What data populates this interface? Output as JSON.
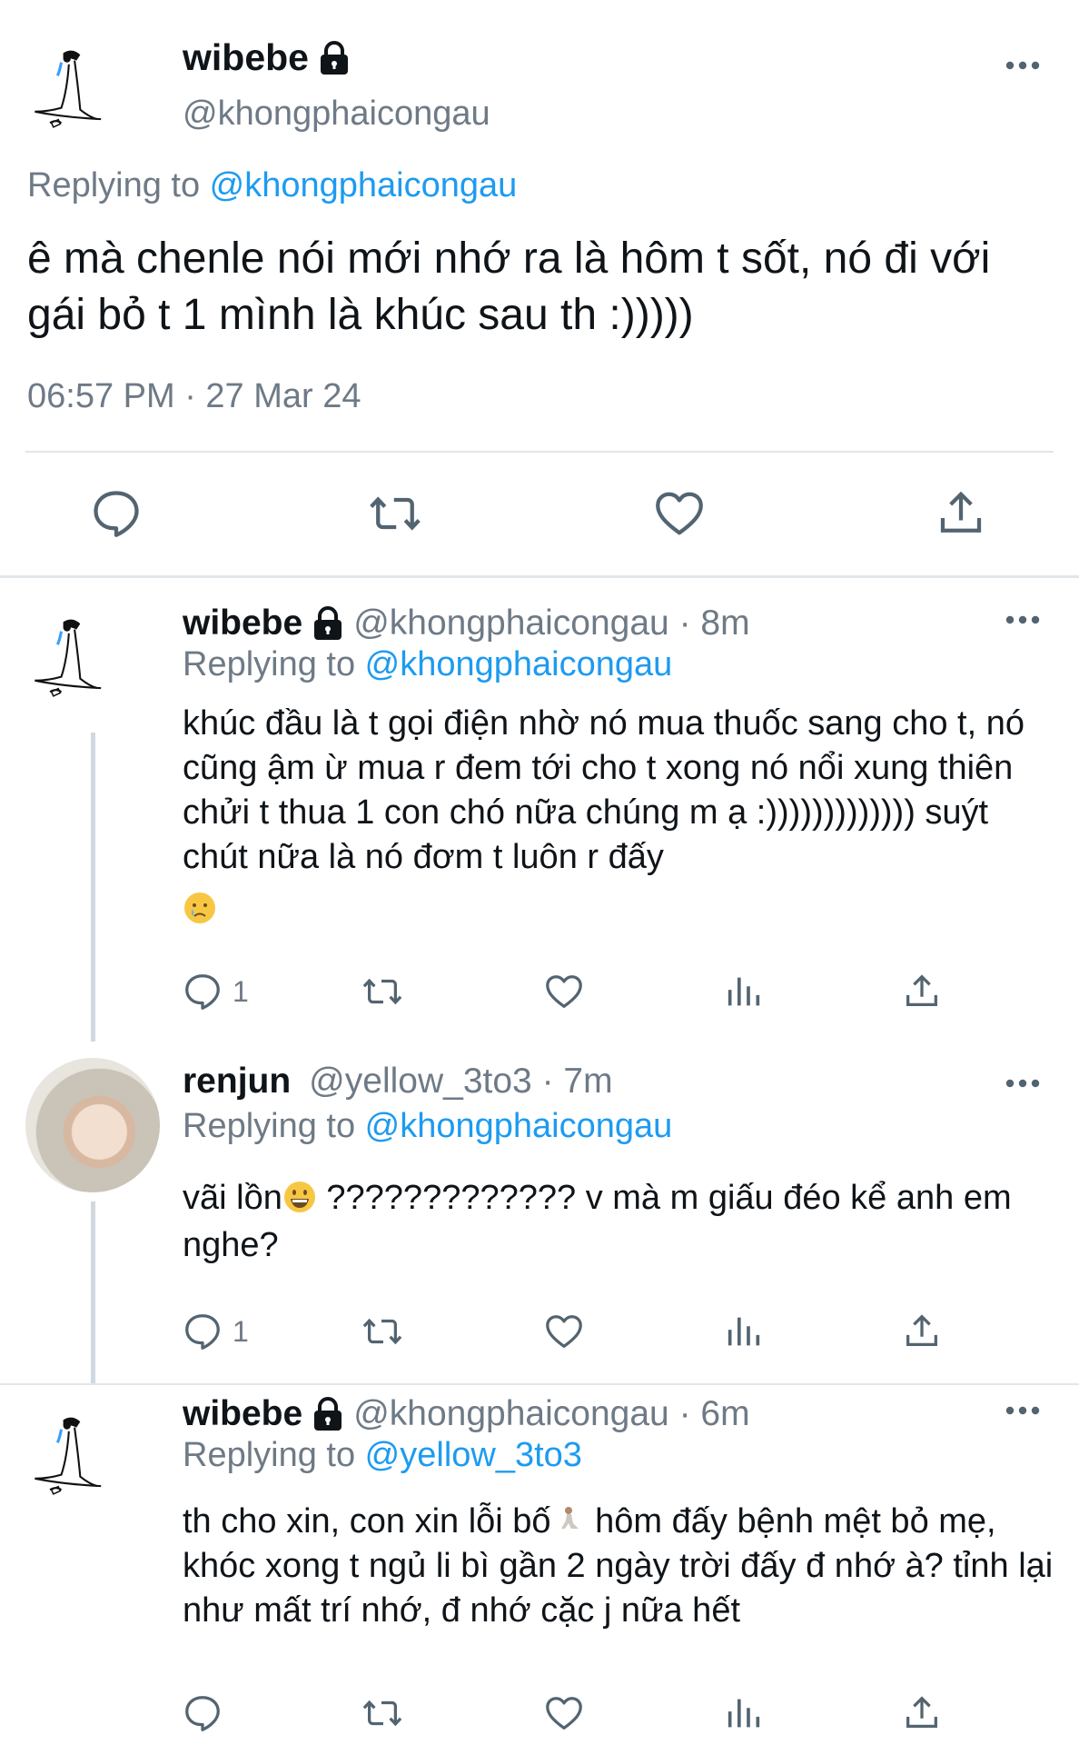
{
  "main": {
    "name": "wibebe",
    "handle": "@khongphaicongau",
    "replying_prefix": "Replying to ",
    "replying_to": "@khongphaicongau",
    "text": "ê mà chenle nói mới nhớ ra là hôm t sốt, nó đi với gái bỏ t 1 mình là khúc sau th :)))))",
    "timestamp": "06:57 PM · 27 Mar 24"
  },
  "replies": [
    {
      "name": "wibebe",
      "meta": "@khongphaicongau · 8m",
      "replying_prefix": "Replying to ",
      "replying_to": "@khongphaicongau",
      "text": "khúc đầu là t gọi điện nhờ nó mua thuốc sang cho t, nó cũng ậm ừ mua r đem tới cho t xong nó nổi xung thiên chửi t thua 1 con chó nữa chúng m ạ :))))))))))))) suýt chút nữa là nó đơm t luôn r đấy",
      "emoji": "crying-face",
      "reply_count": "1"
    },
    {
      "name": "renjun",
      "meta": "@yellow_3to3 · 7m",
      "replying_prefix": "Replying to ",
      "replying_to": "@khongphaicongau",
      "text_before_emoji": "vãi lồn",
      "text_after_emoji": " ????????????? v mà m giấu đéo kể anh em nghe?",
      "emoji": "grinning-face",
      "reply_count": "1"
    },
    {
      "name": "wibebe",
      "meta": "@khongphaicongau · 6m",
      "replying_prefix": "Replying to ",
      "replying_to": "@yellow_3to3",
      "text_before_emoji": "th cho xin, con xin lỗi bố",
      "text_after_emoji": "  hôm đấy bệnh mệt bỏ mẹ, khóc xong t ngủ li bì gần 2 ngày trời đấy đ nhớ à? tỉnh lại như mất trí nhớ, đ nhớ cặc j nữa hết",
      "emoji": "kneeling-figure",
      "reply_count": ""
    }
  ],
  "colors": {
    "link": "#1d9bf0",
    "secondary_text": "#6e7a86",
    "divider": "#e1e6ea",
    "icon": "#536471"
  }
}
